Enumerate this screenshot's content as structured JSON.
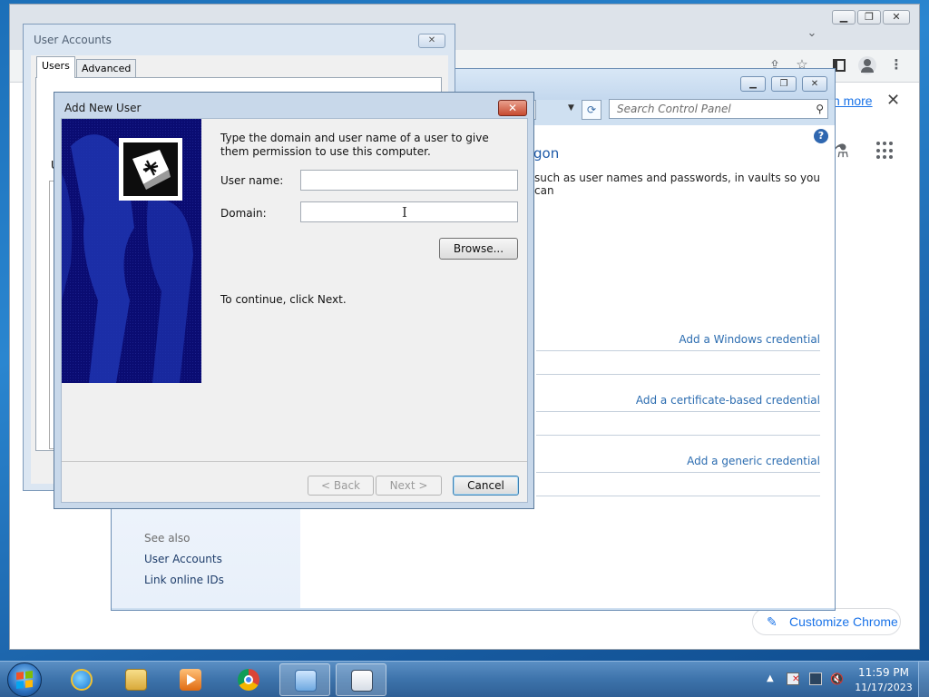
{
  "chrome": {
    "learn_more": "n more",
    "customize_label": "Customize Chrome",
    "icons": [
      "share-icon",
      "star-icon",
      "side-panel-icon",
      "profile-icon",
      "kebab-menu-icon"
    ]
  },
  "credential_manager": {
    "search_placeholder": "Search Control Panel",
    "heading_fragment": "gon",
    "description_fragment": "such as user names and passwords, in vaults so you can",
    "add_windows_credential": "Add a Windows credential",
    "add_certificate_credential": "Add a certificate-based credential",
    "add_generic_credential": "Add a generic credential",
    "see_also": "See also",
    "user_accounts_link": "User Accounts",
    "link_online_ids": "Link online IDs"
  },
  "user_accounts": {
    "title": "User Accounts",
    "tabs": [
      "Users",
      "Advanced"
    ],
    "fragment_u": "U"
  },
  "dialog": {
    "title": "Add New User",
    "instruction": "Type the domain and user name of a user to give them permission to use this computer.",
    "user_name_label": "User name:",
    "user_name_value": "",
    "domain_label": "Domain:",
    "domain_value": "",
    "browse_label": "Browse...",
    "continue_text": "To continue, click Next.",
    "back_label": "< Back",
    "next_label": "Next >",
    "cancel_label": "Cancel"
  },
  "taskbar": {
    "time": "11:59 PM",
    "date": "11/17/2023",
    "pinned": [
      "internet-explorer-icon",
      "file-explorer-icon",
      "media-player-icon",
      "chrome-icon",
      "control-panel-icon",
      "user-accounts-icon"
    ]
  },
  "colors": {
    "link_blue": "#2b6cb0",
    "chrome_blue": "#1a73e8",
    "dialog_art": "#0a0c72"
  }
}
